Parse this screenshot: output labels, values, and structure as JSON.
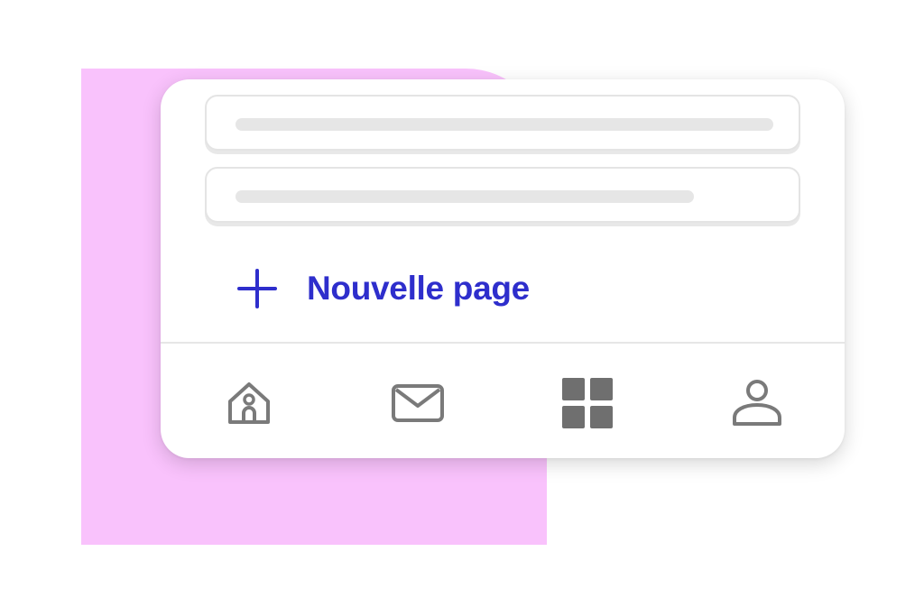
{
  "colors": {
    "accent": "#2e2ecc",
    "blob": "#f9c2fc",
    "icon_gray": "#7a7a7a",
    "icon_active": "#6f6f6f"
  },
  "list": {
    "rows": [
      {
        "type": "placeholder"
      },
      {
        "type": "placeholder"
      }
    ]
  },
  "actions": {
    "new_page_label": "Nouvelle page",
    "new_page_icon": "plus-icon"
  },
  "nav": {
    "items": [
      {
        "name": "home",
        "icon": "home-icon"
      },
      {
        "name": "mail",
        "icon": "mail-icon"
      },
      {
        "name": "apps",
        "icon": "grid-icon",
        "active": true
      },
      {
        "name": "profile",
        "icon": "user-icon"
      }
    ]
  }
}
